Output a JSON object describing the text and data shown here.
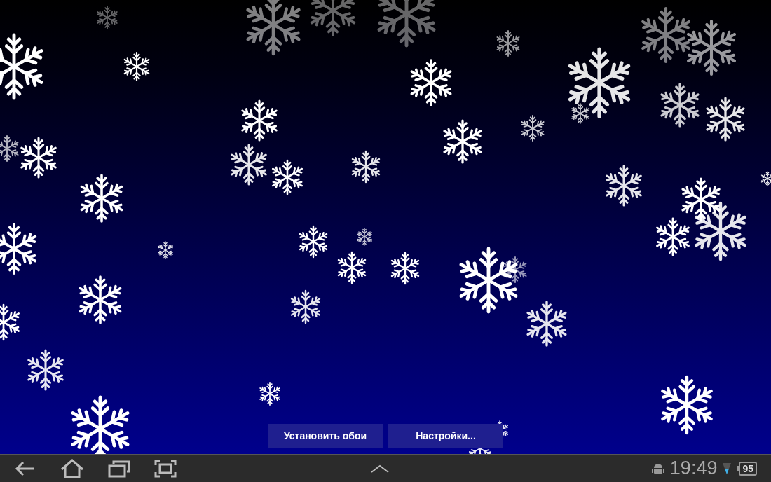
{
  "buttons": [
    {
      "label": "Установить обои"
    },
    {
      "label": "Настройки..."
    }
  ],
  "status_bar": {
    "time": "19:49",
    "battery": "95"
  }
}
